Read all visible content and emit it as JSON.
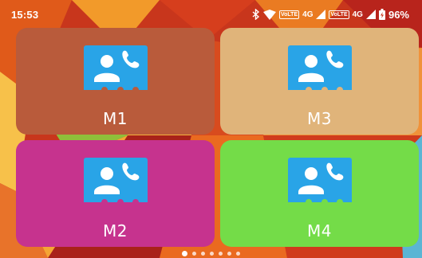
{
  "status_bar": {
    "time": "15:53",
    "volte_1": "VoLTE",
    "network_1": "4G",
    "volte_2": "VoLTE",
    "network_2": "4G",
    "battery": "96%"
  },
  "tiles": [
    {
      "label": "M1",
      "color": "#b95b3b",
      "icon": "contact-card-icon"
    },
    {
      "label": "M3",
      "color": "#e0b47a",
      "icon": "contact-card-icon"
    },
    {
      "label": "M2",
      "color": "#c6338e",
      "icon": "contact-card-icon"
    },
    {
      "label": "M4",
      "color": "#74dc48",
      "icon": "contact-card-icon"
    }
  ],
  "page_indicator": {
    "total": 7,
    "active": 0
  },
  "colors": {
    "icon_card": "#29a4e7",
    "icon_glyph": "#ffffff"
  }
}
